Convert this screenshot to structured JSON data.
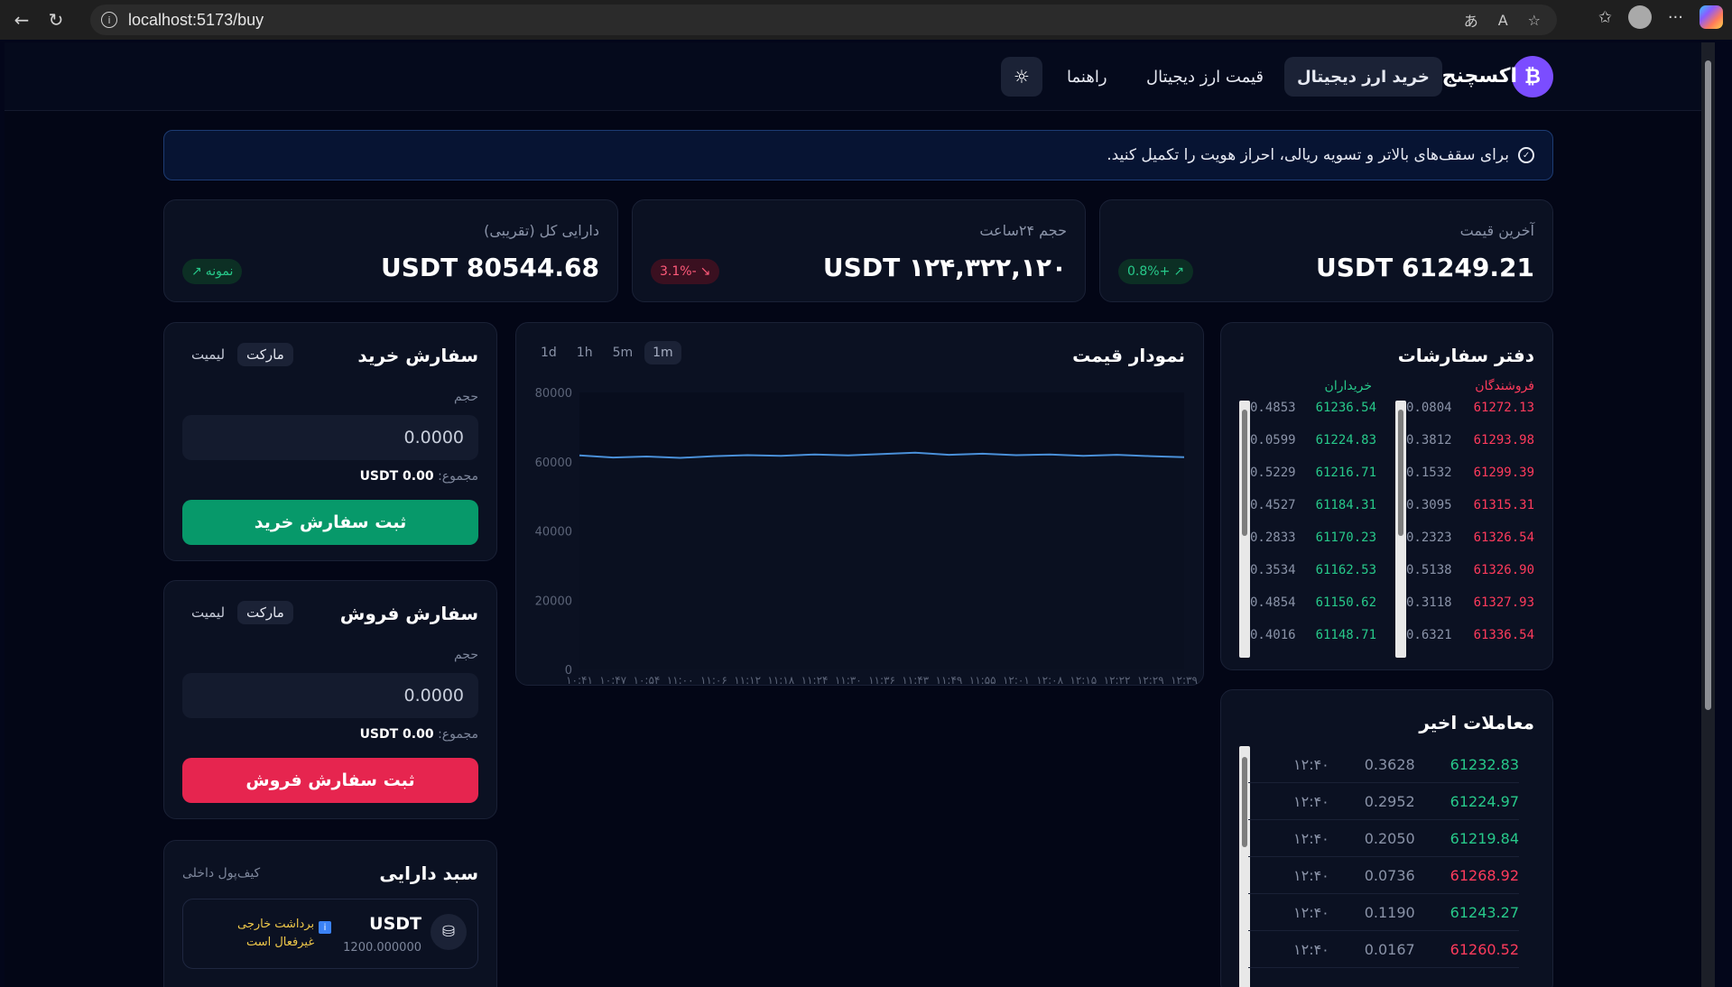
{
  "browser": {
    "url": "localhost:5173/buy"
  },
  "nav": {
    "brand": "اکسچنج‌فا",
    "logo_symbol": "₿",
    "items": [
      "خرید ارز دیجیتال",
      "قیمت ارز دیجیتال",
      "راهنما"
    ]
  },
  "notice": {
    "text": "برای سقف‌های بالاتر و تسویه ریالی، احراز هویت را تکمیل کنید."
  },
  "stats": [
    {
      "label": "آخرین قیمت",
      "value": "USDT 61249.21",
      "badge": "0.8%+",
      "trend": "up"
    },
    {
      "label": "حجم ۲۴ساعت",
      "value": "USDT ۱۲۴,۳۲۲,۱۲۰",
      "badge": "3.1%-",
      "trend": "down"
    },
    {
      "label": "دارایی کل (تقریبی)",
      "value": "USDT 80544.68",
      "badge": "نمونه",
      "trend": "up"
    }
  ],
  "buy_panel": {
    "title": "سفارش خرید",
    "tabs": [
      "مارکت",
      "لیمیت"
    ],
    "volume_label": "حجم",
    "volume_placeholder": "0.0000",
    "total_label": "مجموع:",
    "total_value": "USDT 0.00",
    "submit": "ثبت سفارش خرید"
  },
  "sell_panel": {
    "title": "سفارش فروش",
    "tabs": [
      "مارکت",
      "لیمیت"
    ],
    "volume_label": "حجم",
    "volume_placeholder": "0.0000",
    "total_label": "مجموع:",
    "total_value": "USDT 0.00",
    "submit": "ثبت سفارش فروش"
  },
  "portfolio": {
    "title": "سبد دارایی",
    "subtitle": "کیف‌پول داخلی",
    "asset": "USDT",
    "amount": "1200.000000",
    "note_line1": "برداشت خارجی",
    "note_line2": "غیرفعال است"
  },
  "chart_panel": {
    "title": "نمودار قیمت",
    "timeframes": [
      "1d",
      "1h",
      "5m",
      "1m"
    ],
    "active": "1m"
  },
  "chart_data": {
    "type": "area",
    "ylim": [
      0,
      80000
    ],
    "yticks": [
      "80000",
      "60000",
      "40000",
      "20000",
      "0"
    ],
    "categories": [
      "۱۰:۴۱",
      "۱۰:۴۷",
      "۱۰:۵۴",
      "۱۱:۰۰",
      "۱۱:۰۶",
      "۱۱:۱۲",
      "۱۱:۱۸",
      "۱۱:۲۴",
      "۱۱:۳۰",
      "۱۱:۳۶",
      "۱۱:۴۳",
      "۱۱:۴۹",
      "۱۱:۵۵",
      "۱۲:۰۱",
      "۱۲:۰۸",
      "۱۲:۱۵",
      "۱۲:۲۲",
      "۱۲:۲۹",
      "۱۲:۳۹"
    ],
    "values": [
      61800,
      61200,
      61500,
      61100,
      61600,
      61900,
      61700,
      62100,
      61800,
      62200,
      62600,
      62000,
      62300,
      61900,
      62100,
      61700,
      62000,
      61600,
      61300
    ],
    "color": "#4a90d9"
  },
  "orderbook": {
    "title": "دفتر سفارشات",
    "sellers_label": "فروشندگان",
    "buyers_label": "خریداران",
    "sellers": [
      {
        "price": "61272.13",
        "amount": "0.0804"
      },
      {
        "price": "61293.98",
        "amount": "0.3812"
      },
      {
        "price": "61299.39",
        "amount": "0.1532"
      },
      {
        "price": "61315.31",
        "amount": "0.3095"
      },
      {
        "price": "61326.54",
        "amount": "0.2323"
      },
      {
        "price": "61326.90",
        "amount": "0.5138"
      },
      {
        "price": "61327.93",
        "amount": "0.3118"
      },
      {
        "price": "61336.54",
        "amount": "0.6321"
      }
    ],
    "buyers": [
      {
        "price": "61236.54",
        "amount": "0.4853"
      },
      {
        "price": "61224.83",
        "amount": "0.0599"
      },
      {
        "price": "61216.71",
        "amount": "0.5229"
      },
      {
        "price": "61184.31",
        "amount": "0.4527"
      },
      {
        "price": "61170.23",
        "amount": "0.2833"
      },
      {
        "price": "61162.53",
        "amount": "0.3534"
      },
      {
        "price": "61150.62",
        "amount": "0.4854"
      },
      {
        "price": "61148.71",
        "amount": "0.4016"
      }
    ]
  },
  "trades": {
    "title": "معاملات اخیر",
    "rows": [
      {
        "price": "61232.83",
        "amount": "0.3628",
        "time": "۱۲:۴۰",
        "side": "buy"
      },
      {
        "price": "61224.97",
        "amount": "0.2952",
        "time": "۱۲:۴۰",
        "side": "buy"
      },
      {
        "price": "61219.84",
        "amount": "0.2050",
        "time": "۱۲:۴۰",
        "side": "buy"
      },
      {
        "price": "61268.92",
        "amount": "0.0736",
        "time": "۱۲:۴۰",
        "side": "sell"
      },
      {
        "price": "61243.27",
        "amount": "0.1190",
        "time": "۱۲:۴۰",
        "side": "buy"
      },
      {
        "price": "61260.52",
        "amount": "0.0167",
        "time": "۱۲:۴۰",
        "side": "sell"
      }
    ]
  },
  "colors": {
    "green": "#27c98a",
    "red": "#ff3b5c",
    "accent": "#7b4dff"
  }
}
